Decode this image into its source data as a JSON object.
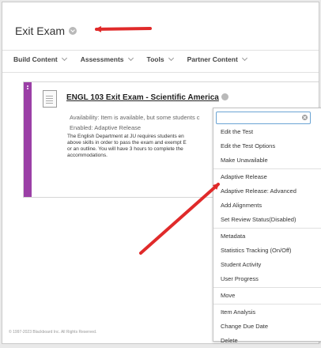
{
  "page": {
    "title": "Exit Exam"
  },
  "menubar": {
    "items": [
      "Build Content",
      "Assessments",
      "Tools",
      "Partner Content"
    ]
  },
  "content_item": {
    "title": "ENGL 103 Exit Exam - Scientific America",
    "availability": "Availability:  Item is available, but some students c",
    "enabled": "Enabled:  Adaptive Release",
    "description": "The English Department at JU requires students en\nabove skills in order to pass the exam and exempt E\nor an outline. You will have 3 hours to complete the\naccommodations."
  },
  "dropdown": {
    "search_value": "",
    "groups": [
      [
        "Edit the Test",
        "Edit the Test Options",
        "Make Unavailable"
      ],
      [
        "Adaptive Release",
        "Adaptive Release: Advanced",
        "Add Alignments",
        "Set Review Status(Disabled)"
      ],
      [
        "Metadata",
        "Statistics Tracking (On/Off)",
        "Student Activity",
        "User Progress"
      ],
      [
        "Move"
      ],
      [
        "Item Analysis",
        "Change Due Date",
        "Delete"
      ]
    ]
  },
  "footer": {
    "text": "© 1997-2023 Blackboard Inc. All Rights Reserved."
  },
  "colors": {
    "accent_purple": "#9b3fa6",
    "annotation_red": "#e02a2a",
    "search_border": "#6ba4d4"
  }
}
